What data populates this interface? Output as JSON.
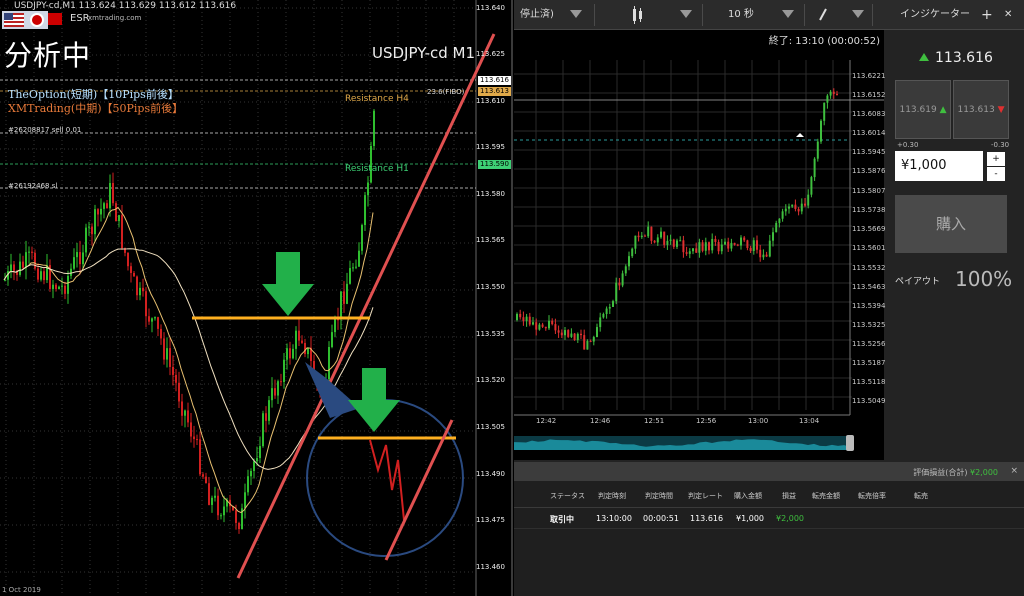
{
  "mt4": {
    "title": "USDJPY-cd,M1  113.624 113.629 113.612 113.616",
    "brand_mark": "ESR",
    "site": "xmtrading.com",
    "analysis_label": "分析中",
    "symbol_label": "USDJPY-cd M1",
    "indicator_1": "TheOption(短期)【10Pips前後】",
    "indicator_2": "XMTrading(中期)【50Pips前後】",
    "order_1": "#26208817 sell 0.01",
    "order_2": "#26192468 sl",
    "resistance_h4": "Resistance H4",
    "resistance_h1": "Resistance H1",
    "fibo_label": "23.6(FIBO)",
    "axis_labels": [
      "113.640",
      "113.625",
      "113.610",
      "113.595",
      "113.580",
      "113.565",
      "113.550",
      "113.535",
      "113.520",
      "113.505",
      "113.490",
      "113.475",
      "113.460"
    ],
    "price_tag_bid": "113.616",
    "price_tag_ask": "113.613",
    "price_tag_line": "113.590",
    "footer": "1 Oct 2019",
    "colors": {
      "bull": "#2fbf2f",
      "bear": "#d22020",
      "trendline": "#e05050",
      "level": "#ffb020",
      "arrow": "#22b04a",
      "circle": "#2a4a80"
    }
  },
  "platform": {
    "topbar": {
      "sort_label": "停止済)",
      "candle_icon": "candlestick-icon",
      "timeframe": "10 秒",
      "draw_icon": "pen-icon",
      "indicator_label": "インジケーター",
      "add_icon": "plus-icon",
      "close_icon": "close-icon"
    },
    "expiry": "終了: 13:10 (00:00:52)",
    "axis_labels": [
      "113.6221",
      "113.6152",
      "113.6083",
      "113.6014",
      "113.5945",
      "113.5876",
      "113.5807",
      "113.5738",
      "113.5669",
      "113.5601",
      "113.5532",
      "113.5463",
      "113.5394",
      "113.5325",
      "113.5256",
      "113.5187",
      "113.5118",
      "113.5049"
    ],
    "x_labels": [
      "12:42",
      "12:46",
      "12:51",
      "12:56",
      "13:00",
      "13:04"
    ],
    "current_price": "113.616",
    "ask_quote": "113.619",
    "bid_quote": "113.613",
    "plus_payout": "+0.30",
    "minus_payout": "-0.30",
    "amount": "¥1,000",
    "step_plus": "+",
    "step_minus": "-",
    "buy_label": "購入",
    "payout_label": "ペイアウト",
    "payout_value": "100%",
    "pnl_label": "評価損益(合計)",
    "pnl_value": "¥2,000",
    "table_headers": [
      "ステータス",
      "判定時刻",
      "判定時間",
      "判定レート",
      "購入金額",
      "損益",
      "転売金額",
      "転売倍率",
      "転売"
    ],
    "table_row": [
      "取引中",
      "13:10:00",
      "00:00:51",
      "113.616",
      "¥1,000",
      "¥2,000"
    ],
    "colors": {
      "up": "#3fbf3f",
      "down": "#e03030",
      "profit": "#3fbf3f"
    }
  }
}
